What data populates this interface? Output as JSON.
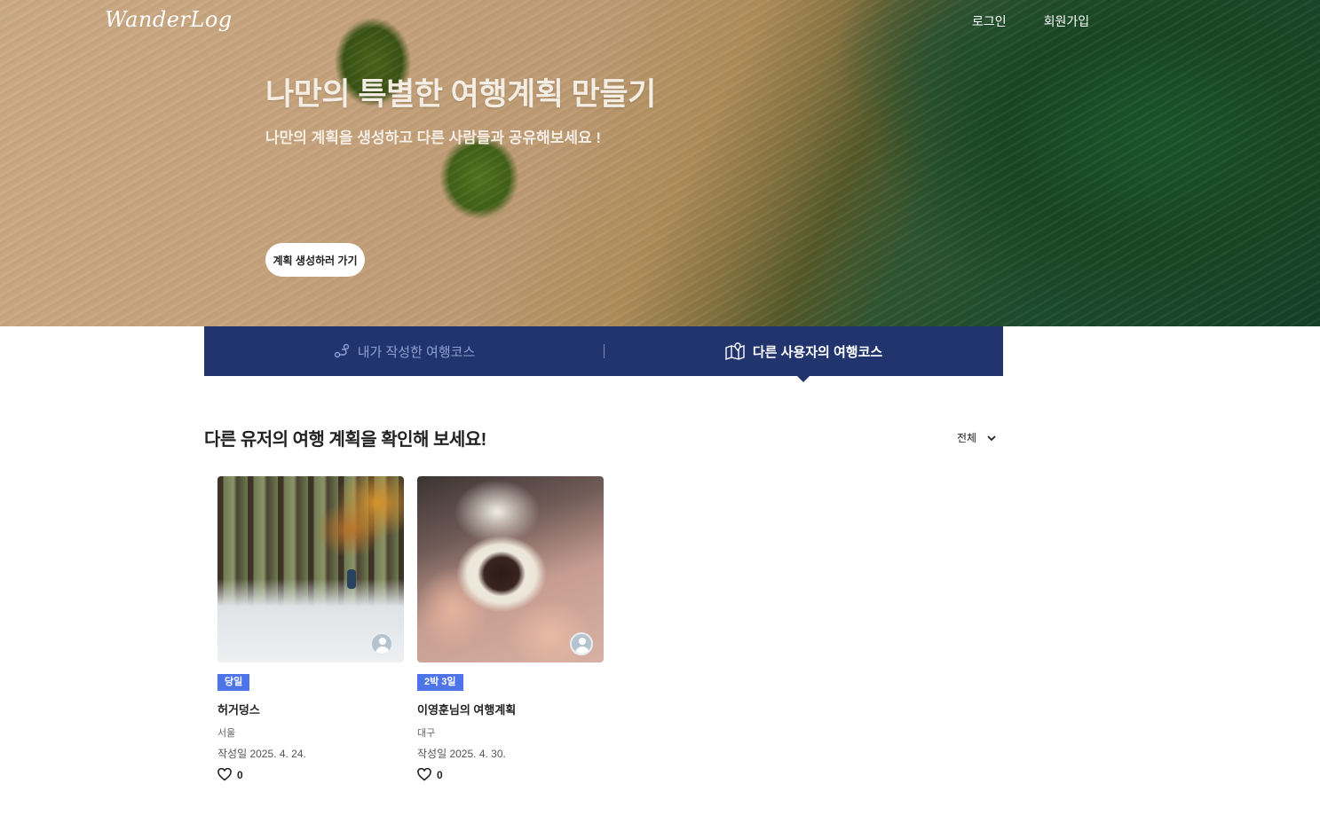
{
  "header": {
    "logo": "WanderLog",
    "nav": {
      "login": "로그인",
      "signup": "회원가입"
    }
  },
  "hero": {
    "title": "나만의 특별한 여행계획 만들기",
    "subtitle": "나만의 계획을 생성하고 다른 사람들과 공유해보세요 !",
    "cta": "계획 생성하러 가기"
  },
  "tabs": {
    "mine": "내가 작성한 여행코스",
    "others": "다른 사용자의 여행코스",
    "active": "others"
  },
  "section": {
    "title": "다른 유저의 여행 계획을 확인해 보세요!",
    "filter": "전체"
  },
  "cards": [
    {
      "badge": "당일",
      "title": "허거덩스",
      "location": "서울",
      "date": "작성일 2025. 4. 24.",
      "likes": "0"
    },
    {
      "badge": "2박 3일",
      "title": "이영훈님의 여행계획",
      "location": "대구",
      "date": "작성일 2025. 4. 30.",
      "likes": "0"
    }
  ],
  "colors": {
    "tab_bg": "#22346e",
    "badge": "#4d74e8"
  }
}
